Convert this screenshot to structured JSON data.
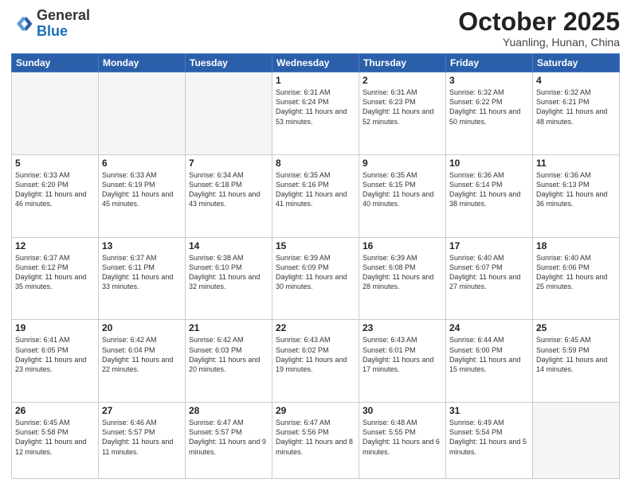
{
  "header": {
    "logo_general": "General",
    "logo_blue": "Blue",
    "month": "October 2025",
    "location": "Yuanling, Hunan, China"
  },
  "weekdays": [
    "Sunday",
    "Monday",
    "Tuesday",
    "Wednesday",
    "Thursday",
    "Friday",
    "Saturday"
  ],
  "weeks": [
    [
      {
        "day": "",
        "info": ""
      },
      {
        "day": "",
        "info": ""
      },
      {
        "day": "",
        "info": ""
      },
      {
        "day": "1",
        "info": "Sunrise: 6:31 AM\nSunset: 6:24 PM\nDaylight: 11 hours\nand 53 minutes."
      },
      {
        "day": "2",
        "info": "Sunrise: 6:31 AM\nSunset: 6:23 PM\nDaylight: 11 hours\nand 52 minutes."
      },
      {
        "day": "3",
        "info": "Sunrise: 6:32 AM\nSunset: 6:22 PM\nDaylight: 11 hours\nand 50 minutes."
      },
      {
        "day": "4",
        "info": "Sunrise: 6:32 AM\nSunset: 6:21 PM\nDaylight: 11 hours\nand 48 minutes."
      }
    ],
    [
      {
        "day": "5",
        "info": "Sunrise: 6:33 AM\nSunset: 6:20 PM\nDaylight: 11 hours\nand 46 minutes."
      },
      {
        "day": "6",
        "info": "Sunrise: 6:33 AM\nSunset: 6:19 PM\nDaylight: 11 hours\nand 45 minutes."
      },
      {
        "day": "7",
        "info": "Sunrise: 6:34 AM\nSunset: 6:18 PM\nDaylight: 11 hours\nand 43 minutes."
      },
      {
        "day": "8",
        "info": "Sunrise: 6:35 AM\nSunset: 6:16 PM\nDaylight: 11 hours\nand 41 minutes."
      },
      {
        "day": "9",
        "info": "Sunrise: 6:35 AM\nSunset: 6:15 PM\nDaylight: 11 hours\nand 40 minutes."
      },
      {
        "day": "10",
        "info": "Sunrise: 6:36 AM\nSunset: 6:14 PM\nDaylight: 11 hours\nand 38 minutes."
      },
      {
        "day": "11",
        "info": "Sunrise: 6:36 AM\nSunset: 6:13 PM\nDaylight: 11 hours\nand 36 minutes."
      }
    ],
    [
      {
        "day": "12",
        "info": "Sunrise: 6:37 AM\nSunset: 6:12 PM\nDaylight: 11 hours\nand 35 minutes."
      },
      {
        "day": "13",
        "info": "Sunrise: 6:37 AM\nSunset: 6:11 PM\nDaylight: 11 hours\nand 33 minutes."
      },
      {
        "day": "14",
        "info": "Sunrise: 6:38 AM\nSunset: 6:10 PM\nDaylight: 11 hours\nand 32 minutes."
      },
      {
        "day": "15",
        "info": "Sunrise: 6:39 AM\nSunset: 6:09 PM\nDaylight: 11 hours\nand 30 minutes."
      },
      {
        "day": "16",
        "info": "Sunrise: 6:39 AM\nSunset: 6:08 PM\nDaylight: 11 hours\nand 28 minutes."
      },
      {
        "day": "17",
        "info": "Sunrise: 6:40 AM\nSunset: 6:07 PM\nDaylight: 11 hours\nand 27 minutes."
      },
      {
        "day": "18",
        "info": "Sunrise: 6:40 AM\nSunset: 6:06 PM\nDaylight: 11 hours\nand 25 minutes."
      }
    ],
    [
      {
        "day": "19",
        "info": "Sunrise: 6:41 AM\nSunset: 6:05 PM\nDaylight: 11 hours\nand 23 minutes."
      },
      {
        "day": "20",
        "info": "Sunrise: 6:42 AM\nSunset: 6:04 PM\nDaylight: 11 hours\nand 22 minutes."
      },
      {
        "day": "21",
        "info": "Sunrise: 6:42 AM\nSunset: 6:03 PM\nDaylight: 11 hours\nand 20 minutes."
      },
      {
        "day": "22",
        "info": "Sunrise: 6:43 AM\nSunset: 6:02 PM\nDaylight: 11 hours\nand 19 minutes."
      },
      {
        "day": "23",
        "info": "Sunrise: 6:43 AM\nSunset: 6:01 PM\nDaylight: 11 hours\nand 17 minutes."
      },
      {
        "day": "24",
        "info": "Sunrise: 6:44 AM\nSunset: 6:00 PM\nDaylight: 11 hours\nand 15 minutes."
      },
      {
        "day": "25",
        "info": "Sunrise: 6:45 AM\nSunset: 5:59 PM\nDaylight: 11 hours\nand 14 minutes."
      }
    ],
    [
      {
        "day": "26",
        "info": "Sunrise: 6:45 AM\nSunset: 5:58 PM\nDaylight: 11 hours\nand 12 minutes."
      },
      {
        "day": "27",
        "info": "Sunrise: 6:46 AM\nSunset: 5:57 PM\nDaylight: 11 hours\nand 11 minutes."
      },
      {
        "day": "28",
        "info": "Sunrise: 6:47 AM\nSunset: 5:57 PM\nDaylight: 11 hours\nand 9 minutes."
      },
      {
        "day": "29",
        "info": "Sunrise: 6:47 AM\nSunset: 5:56 PM\nDaylight: 11 hours\nand 8 minutes."
      },
      {
        "day": "30",
        "info": "Sunrise: 6:48 AM\nSunset: 5:55 PM\nDaylight: 11 hours\nand 6 minutes."
      },
      {
        "day": "31",
        "info": "Sunrise: 6:49 AM\nSunset: 5:54 PM\nDaylight: 11 hours\nand 5 minutes."
      },
      {
        "day": "",
        "info": ""
      }
    ]
  ]
}
